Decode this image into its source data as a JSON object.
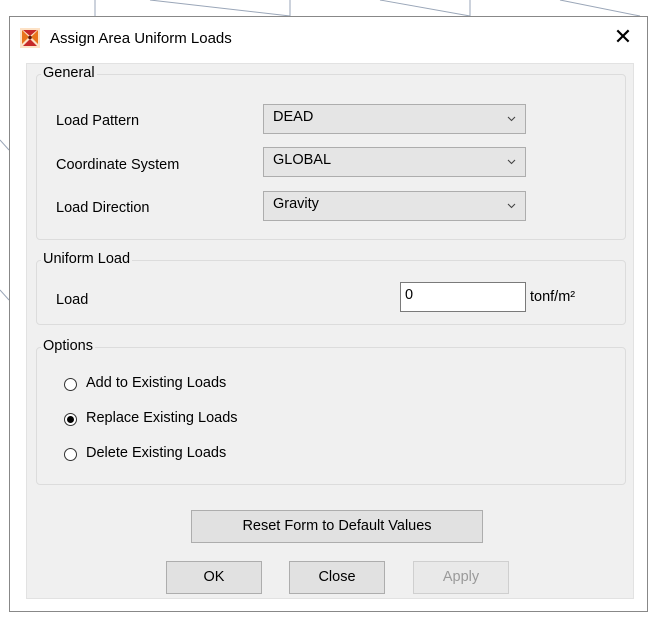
{
  "dialog": {
    "title": "Assign Area Uniform Loads",
    "close_glyph": "✕"
  },
  "general": {
    "legend": "General",
    "load_pattern": {
      "label": "Load Pattern",
      "value": "DEAD"
    },
    "coordinate_system": {
      "label": "Coordinate System",
      "value": "GLOBAL"
    },
    "load_direction": {
      "label": "Load Direction",
      "value": "Gravity"
    }
  },
  "uniform_load": {
    "legend": "Uniform Load",
    "load_label": "Load",
    "load_value": "0",
    "unit": "tonf/m²"
  },
  "options": {
    "legend": "Options",
    "items": [
      {
        "label": "Add to Existing Loads",
        "selected": false
      },
      {
        "label": "Replace Existing Loads",
        "selected": true
      },
      {
        "label": "Delete Existing Loads",
        "selected": false
      }
    ]
  },
  "buttons": {
    "reset": "Reset Form to Default Values",
    "ok": "OK",
    "close": "Close",
    "apply": "Apply"
  },
  "icons": {
    "app": "etabs-app-icon",
    "close": "close-icon",
    "dropdown": "chevron-down-icon"
  },
  "colors": {
    "panel_bg": "#f0f0f0",
    "button_bg": "#e1e1e1",
    "app_icon_orange": "#e8741c",
    "app_icon_red": "#c62828"
  }
}
